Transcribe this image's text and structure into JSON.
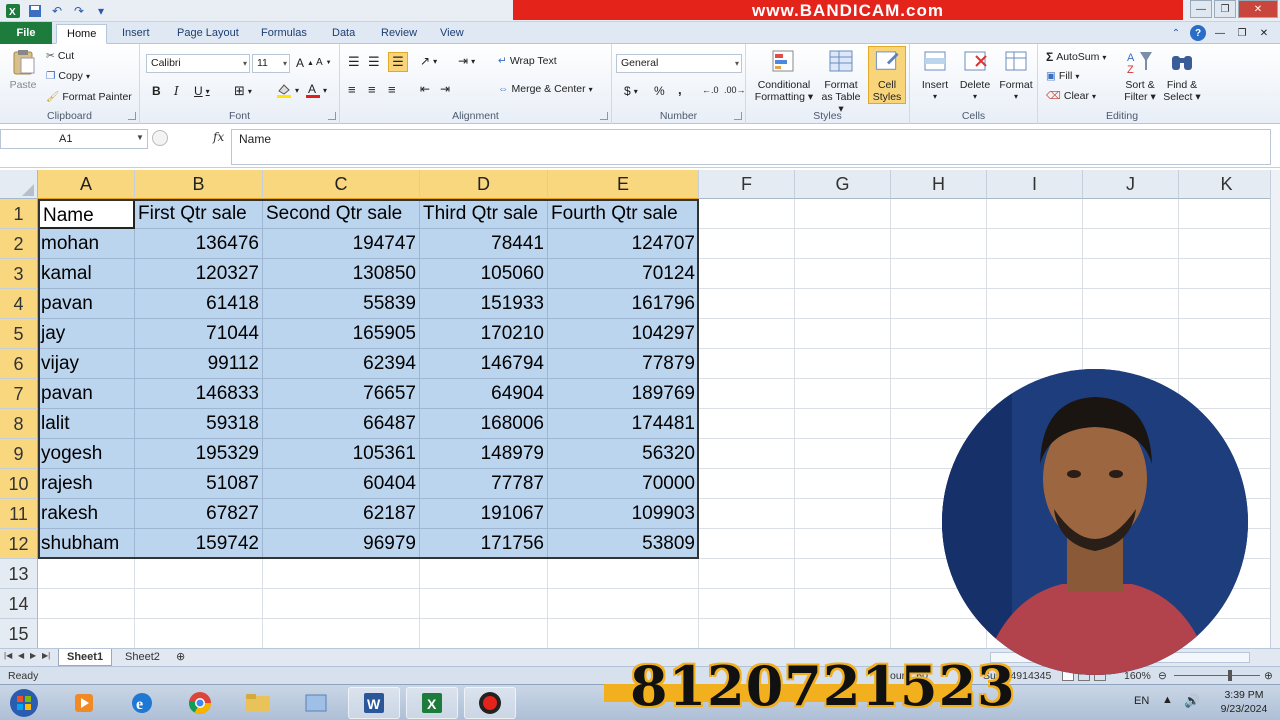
{
  "recording_banner": "www.BANDICAM.com",
  "menu": {
    "file": "File",
    "tabs": [
      "Home",
      "Insert",
      "Page Layout",
      "Formulas",
      "Data",
      "Review",
      "View"
    ]
  },
  "ribbon": {
    "clipboard": {
      "label": "Clipboard",
      "paste": "Paste",
      "cut": "Cut",
      "copy": "Copy",
      "format_painter": "Format Painter"
    },
    "font": {
      "label": "Font",
      "family": "Calibri",
      "size": "11"
    },
    "alignment": {
      "label": "Alignment",
      "wrap_text": "Wrap Text",
      "merge_center": "Merge & Center"
    },
    "number": {
      "label": "Number",
      "format": "General",
      "currency": "$",
      "percent": "%",
      "comma": ","
    },
    "styles": {
      "label": "Styles",
      "conditional_1": "Conditional",
      "conditional_2": "Formatting",
      "format_table_1": "Format",
      "format_table_2": "as Table",
      "cell_styles_1": "Cell",
      "cell_styles_2": "Styles"
    },
    "cells": {
      "label": "Cells",
      "insert": "Insert",
      "delete": "Delete",
      "format": "Format"
    },
    "editing": {
      "label": "Editing",
      "autosum": "AutoSum",
      "fill": "Fill",
      "clear": "Clear",
      "sort_1": "Sort &",
      "sort_2": "Filter",
      "find_1": "Find &",
      "find_2": "Select"
    }
  },
  "formula_bar": {
    "name_box": "A1",
    "fx": "fx",
    "content": "Name"
  },
  "columns": [
    "A",
    "B",
    "C",
    "D",
    "E",
    "F",
    "G",
    "H",
    "I",
    "J",
    "K"
  ],
  "rows": [
    "1",
    "2",
    "3",
    "4",
    "5",
    "6",
    "7",
    "8",
    "9",
    "10",
    "11",
    "12",
    "13",
    "14",
    "15"
  ],
  "table": {
    "headers": [
      "Name",
      "First Qtr sale",
      "Second Qtr sale",
      "Third Qtr sale",
      "Fourth Qtr sale"
    ],
    "rows": [
      [
        "mohan",
        "136476",
        "194747",
        "78441",
        "124707"
      ],
      [
        "kamal",
        "120327",
        "130850",
        "105060",
        "70124"
      ],
      [
        "pavan",
        "61418",
        "55839",
        "151933",
        "161796"
      ],
      [
        "jay",
        "71044",
        "165905",
        "170210",
        "104297"
      ],
      [
        "vijay",
        "99112",
        "62394",
        "146794",
        "77879"
      ],
      [
        "pavan",
        "146833",
        "76657",
        "64904",
        "189769"
      ],
      [
        "lalit",
        "59318",
        "66487",
        "168006",
        "174481"
      ],
      [
        "yogesh",
        "195329",
        "105361",
        "148979",
        "56320"
      ],
      [
        "rajesh",
        "51087",
        "60404",
        "77787",
        "70000"
      ],
      [
        "rakesh",
        "67827",
        "62187",
        "191067",
        "109903"
      ],
      [
        "shubham",
        "159742",
        "96979",
        "171756",
        "53809"
      ]
    ]
  },
  "sheets": [
    "Sheet1",
    "Sheet2"
  ],
  "status": {
    "ready": "Ready",
    "count": "ount: 60",
    "sum": "Sum: 4914345",
    "zoom": "160%"
  },
  "overlay_phone": "8120721523",
  "tray": {
    "lang": "EN",
    "time": "3:39 PM",
    "date": "9/23/2024"
  },
  "colors": {
    "excel_green": "#1d7c3c",
    "selection": "#bcd5ee",
    "header_selected": "#f9d77e",
    "banner": "#e4231b",
    "phone_band": "#f2b01e"
  }
}
